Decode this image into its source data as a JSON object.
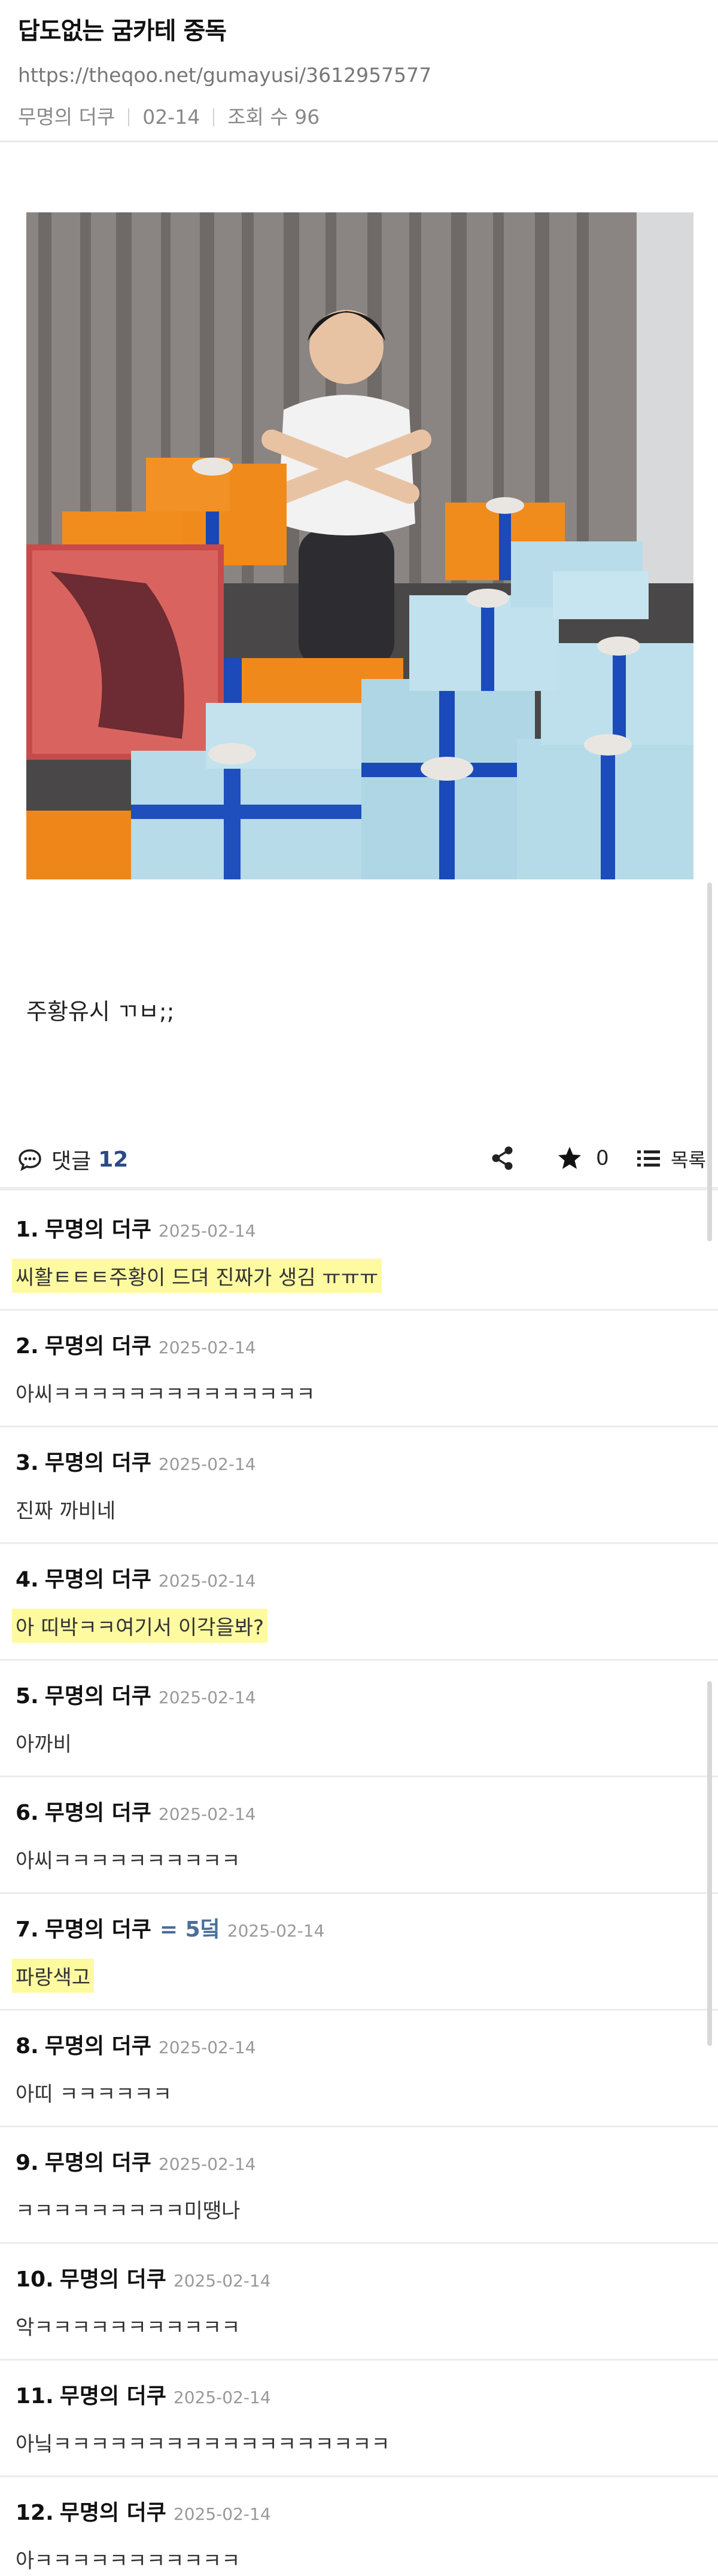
{
  "post": {
    "title": "답도없는 굼카테 중독",
    "url": "https://theqoo.net/gumayusi/3612957577",
    "author": "무명의 더쿠",
    "date": "02-14",
    "views_label": "조회 수 96",
    "text": "주황유시 ㄲㅂ;;"
  },
  "actions": {
    "comment_label": "댓글",
    "comment_count": "12",
    "fav_count": "0",
    "list_label": "목록"
  },
  "colors": {
    "highlight": "#fdfaa0",
    "accent": "#2a4a85"
  },
  "comments": [
    {
      "num": "1.",
      "author": "무명의 더쿠",
      "extra": "",
      "date": "2025-02-14",
      "text": "씨활ㅌㅌㅌ주황이 드뎌 진짜가 생김 ㅠㅠㅠ",
      "highlight": true
    },
    {
      "num": "2.",
      "author": "무명의 더쿠",
      "extra": "",
      "date": "2025-02-14",
      "text": "아씨ㅋㅋㅋㅋㅋㅋㅋㅋㅋㅋㅋㅋㅋㅋ",
      "highlight": false
    },
    {
      "num": "3.",
      "author": "무명의 더쿠",
      "extra": "",
      "date": "2025-02-14",
      "text": "진짜 까비네",
      "highlight": false
    },
    {
      "num": "4.",
      "author": "무명의 더쿠",
      "extra": "",
      "date": "2025-02-14",
      "text": "아 띠박ㅋㅋ여기서 이각을봐?",
      "highlight": true
    },
    {
      "num": "5.",
      "author": "무명의 더쿠",
      "extra": "",
      "date": "2025-02-14",
      "text": "아까비",
      "highlight": false
    },
    {
      "num": "6.",
      "author": "무명의 더쿠",
      "extra": "",
      "date": "2025-02-14",
      "text": "아씨ㅋㅋㅋㅋㅋㅋㅋㅋㅋㅋ",
      "highlight": false
    },
    {
      "num": "7.",
      "author": "무명의 더쿠",
      "extra": "= 5덬",
      "date": "2025-02-14",
      "text": "파랑색고",
      "highlight": true
    },
    {
      "num": "8.",
      "author": "무명의 더쿠",
      "extra": "",
      "date": "2025-02-14",
      "text": "아띠 ㅋㅋㅋㅋㅋㅋ",
      "highlight": false
    },
    {
      "num": "9.",
      "author": "무명의 더쿠",
      "extra": "",
      "date": "2025-02-14",
      "text": "ㅋㅋㅋㅋㅋㅋㅋㅋㅋ미땡나",
      "highlight": false
    },
    {
      "num": "10.",
      "author": "무명의 더쿠",
      "extra": "",
      "date": "2025-02-14",
      "text": "악ㅋㅋㅋㅋㅋㅋㅋㅋㅋㅋㅋ",
      "highlight": false
    },
    {
      "num": "11.",
      "author": "무명의 더쿠",
      "extra": "",
      "date": "2025-02-14",
      "text": "아닠ㅋㅋㅋㅋㅋㅋㅋㅋㅋㅋㅋㅋㅋㅋㅋㅋㅋㅋ",
      "highlight": false
    },
    {
      "num": "12.",
      "author": "무명의 더쿠",
      "extra": "",
      "date": "2025-02-14",
      "text": "아ㅋㅋㅋㅋㅋㅋㅋㅋㅋㅋㅋ",
      "highlight": false
    }
  ]
}
